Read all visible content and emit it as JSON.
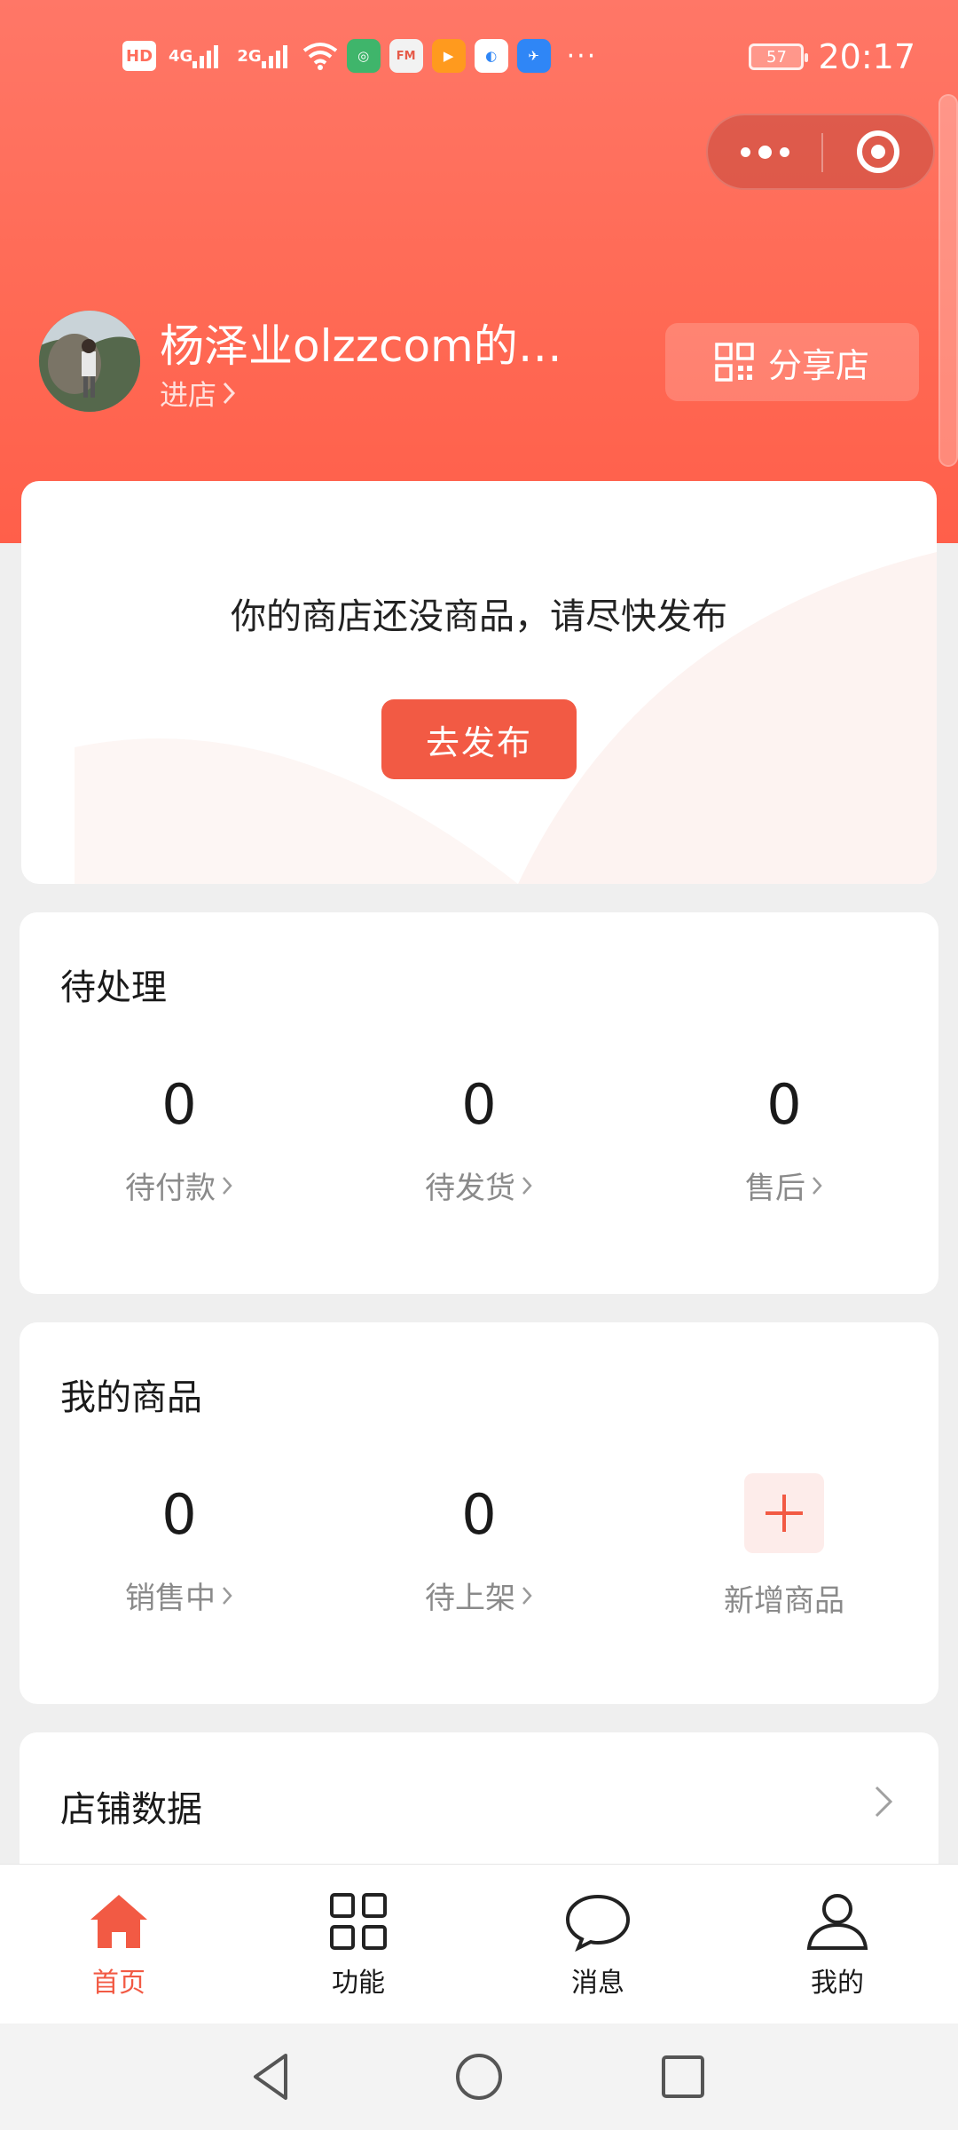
{
  "status_bar": {
    "hd_badge": "HD",
    "sim1": "4G",
    "sim2": "2G",
    "fm_label": "FM",
    "more": "···",
    "battery": "57",
    "time": "20:17"
  },
  "capsule": {
    "more_icon": "more-dots-icon",
    "close_icon": "target-icon"
  },
  "shop": {
    "name": "杨泽业olzzcom的…",
    "enter_label": "进店",
    "share_label": "分享店"
  },
  "empty_card": {
    "message": "你的商店还没商品，请尽快发布",
    "publish_label": "去发布"
  },
  "pending": {
    "title": "待处理",
    "items": [
      {
        "value": "0",
        "label": "待付款"
      },
      {
        "value": "0",
        "label": "待发货"
      },
      {
        "value": "0",
        "label": "售后"
      }
    ]
  },
  "goods": {
    "title": "我的商品",
    "items": [
      {
        "value": "0",
        "label": "销售中"
      },
      {
        "value": "0",
        "label": "待上架"
      }
    ],
    "add_label": "新增商品"
  },
  "store_data": {
    "title": "店铺数据"
  },
  "tabbar": {
    "items": [
      {
        "label": "首页",
        "icon": "home-icon",
        "active": true
      },
      {
        "label": "功能",
        "icon": "grid-icon",
        "active": false
      },
      {
        "label": "消息",
        "icon": "chat-bubble-icon",
        "active": false
      },
      {
        "label": "我的",
        "icon": "person-icon",
        "active": false
      }
    ]
  },
  "colors": {
    "accent": "#f25a44",
    "header": "#ff6a55",
    "background": "#efefef"
  }
}
